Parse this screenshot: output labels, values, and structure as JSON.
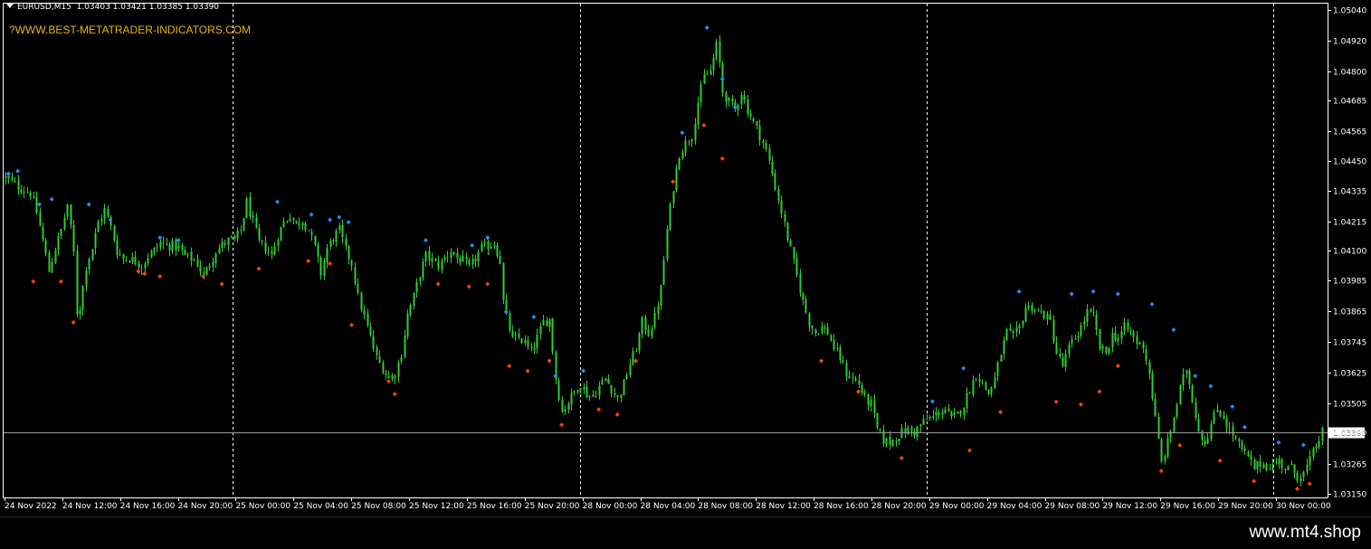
{
  "chart": {
    "symbol": "EURUSD,M15",
    "ohlc": "1.03403 1.03421 1.03385 1.03390",
    "watermark": "?WWW.BEST-METATRADER-INDICATORS.COM",
    "current_price": "1.03390",
    "colors": {
      "background": "#000000",
      "candle": "#32cd32",
      "high_marker": "#1e90ff",
      "low_marker": "#ff4500",
      "watermark": "#e8b317",
      "grid_line": "#ffffff"
    }
  },
  "price_axis": {
    "ticks": [
      "1.05040",
      "1.04920",
      "1.04800",
      "1.04685",
      "1.04565",
      "1.04450",
      "1.04335",
      "1.04215",
      "1.04100",
      "1.03985",
      "1.03865",
      "1.03745",
      "1.03625",
      "1.03505",
      "1.03390",
      "1.03265",
      "1.03150"
    ]
  },
  "time_axis": {
    "labels": [
      "24 Nov 2022",
      "24 Nov 12:00",
      "24 Nov 16:00",
      "24 Nov 20:00",
      "25 Nov 00:00",
      "25 Nov 04:00",
      "25 Nov 08:00",
      "25 Nov 12:00",
      "25 Nov 16:00",
      "25 Nov 20:00",
      "28 Nov 00:00",
      "28 Nov 04:00",
      "28 Nov 08:00",
      "28 Nov 12:00",
      "28 Nov 16:00",
      "28 Nov 20:00",
      "29 Nov 00:00",
      "29 Nov 04:00",
      "29 Nov 08:00",
      "29 Nov 12:00",
      "29 Nov 16:00",
      "29 Nov 20:00",
      "30 Nov 00:00"
    ],
    "day_separators": [
      "25 Nov 00:00",
      "28 Nov 00:00",
      "29 Nov 00:00",
      "30 Nov 00:00"
    ]
  },
  "chart_data": {
    "type": "candlestick",
    "x": [
      "24 Nov 2022",
      "24 Nov 12:00",
      "24 Nov 16:00",
      "24 Nov 20:00",
      "25 Nov 00:00",
      "25 Nov 04:00",
      "25 Nov 08:00",
      "25 Nov 12:00",
      "25 Nov 16:00",
      "25 Nov 20:00",
      "28 Nov 00:00",
      "28 Nov 04:00",
      "28 Nov 08:00",
      "28 Nov 12:00",
      "28 Nov 16:00",
      "28 Nov 20:00",
      "29 Nov 00:00",
      "29 Nov 04:00",
      "29 Nov 08:00",
      "29 Nov 12:00",
      "29 Nov 16:00",
      "29 Nov 20:00",
      "30 Nov 00:00"
    ],
    "close_path": [
      [
        0,
        1.04385
      ],
      [
        4,
        1.0435
      ],
      [
        8,
        1.04325
      ],
      [
        10,
        1.0425
      ],
      [
        12,
        1.0414
      ],
      [
        14,
        1.0402
      ],
      [
        16,
        1.0411
      ],
      [
        18,
        1.0418
      ],
      [
        20,
        1.0428
      ],
      [
        22,
        1.0409
      ],
      [
        23,
        1.0386
      ],
      [
        24,
        1.0388
      ],
      [
        26,
        1.0404
      ],
      [
        28,
        1.0411
      ],
      [
        30,
        1.0421
      ],
      [
        32,
        1.0426
      ],
      [
        34,
        1.0419
      ],
      [
        36,
        1.041
      ],
      [
        38,
        1.0407
      ],
      [
        40,
        1.0407
      ],
      [
        42,
        1.0406
      ],
      [
        44,
        1.0404
      ],
      [
        46,
        1.0408
      ],
      [
        48,
        1.041
      ],
      [
        50,
        1.0413
      ],
      [
        52,
        1.0412
      ],
      [
        54,
        1.0412
      ],
      [
        56,
        1.0411
      ],
      [
        58,
        1.0408
      ],
      [
        60,
        1.0407
      ],
      [
        62,
        1.0405
      ],
      [
        64,
        1.04
      ],
      [
        66,
        1.0405
      ],
      [
        68,
        1.041
      ],
      [
        70,
        1.0412
      ],
      [
        72,
        1.0414
      ],
      [
        74,
        1.0414
      ],
      [
        76,
        1.0418
      ],
      [
        78,
        1.0429
      ],
      [
        80,
        1.0421
      ],
      [
        82,
        1.0413
      ],
      [
        84,
        1.0411
      ],
      [
        86,
        1.0408
      ],
      [
        88,
        1.0416
      ],
      [
        90,
        1.0421
      ],
      [
        92,
        1.0424
      ],
      [
        94,
        1.042
      ],
      [
        96,
        1.0422
      ],
      [
        98,
        1.0418
      ],
      [
        100,
        1.0411
      ],
      [
        102,
        1.0401
      ],
      [
        104,
        1.0411
      ],
      [
        106,
        1.0415
      ],
      [
        108,
        1.0418
      ],
      [
        110,
        1.041
      ],
      [
        112,
        1.0405
      ],
      [
        114,
        1.0392
      ],
      [
        116,
        1.0384
      ],
      [
        118,
        1.0376
      ],
      [
        120,
        1.0368
      ],
      [
        122,
        1.0364
      ],
      [
        124,
        1.036
      ],
      [
        126,
        1.0362
      ],
      [
        128,
        1.037
      ],
      [
        130,
        1.0385
      ],
      [
        132,
        1.0392
      ],
      [
        134,
        1.0401
      ],
      [
        136,
        1.0408
      ],
      [
        138,
        1.0406
      ],
      [
        140,
        1.0404
      ],
      [
        142,
        1.0407
      ],
      [
        144,
        1.041
      ],
      [
        146,
        1.0407
      ],
      [
        148,
        1.0406
      ],
      [
        150,
        1.0403
      ],
      [
        152,
        1.0407
      ],
      [
        154,
        1.0411
      ],
      [
        156,
        1.0412
      ],
      [
        158,
        1.0413
      ],
      [
        160,
        1.0406
      ],
      [
        161,
        1.039
      ],
      [
        162,
        1.0384
      ],
      [
        164,
        1.0375
      ],
      [
        166,
        1.0376
      ],
      [
        168,
        1.0374
      ],
      [
        170,
        1.037
      ],
      [
        172,
        1.0376
      ],
      [
        174,
        1.0382
      ],
      [
        176,
        1.0383
      ],
      [
        178,
        1.036
      ],
      [
        180,
        1.0347
      ],
      [
        182,
        1.0351
      ],
      [
        184,
        1.0355
      ],
      [
        186,
        1.0358
      ],
      [
        188,
        1.0354
      ],
      [
        190,
        1.0353
      ],
      [
        192,
        1.0357
      ],
      [
        194,
        1.036
      ],
      [
        196,
        1.0356
      ],
      [
        198,
        1.0352
      ],
      [
        200,
        1.0358
      ],
      [
        202,
        1.0366
      ],
      [
        204,
        1.0372
      ],
      [
        206,
        1.0382
      ],
      [
        208,
        1.0378
      ],
      [
        210,
        1.0384
      ],
      [
        212,
        1.0395
      ],
      [
        214,
        1.0418
      ],
      [
        216,
        1.0435
      ],
      [
        218,
        1.0448
      ],
      [
        220,
        1.0452
      ],
      [
        222,
        1.0455
      ],
      [
        224,
        1.0468
      ],
      [
        226,
        1.0478
      ],
      [
        228,
        1.048
      ],
      [
        230,
        1.049
      ],
      [
        231,
        1.0483
      ],
      [
        232,
        1.0472
      ],
      [
        234,
        1.0468
      ],
      [
        236,
        1.0465
      ],
      [
        238,
        1.0472
      ],
      [
        240,
        1.0465
      ],
      [
        242,
        1.046
      ],
      [
        244,
        1.0455
      ],
      [
        246,
        1.0449
      ],
      [
        248,
        1.044
      ],
      [
        250,
        1.043
      ],
      [
        252,
        1.042
      ],
      [
        254,
        1.041
      ],
      [
        256,
        1.04
      ],
      [
        258,
        1.039
      ],
      [
        260,
        1.0382
      ],
      [
        262,
        1.0378
      ],
      [
        264,
        1.038
      ],
      [
        266,
        1.0378
      ],
      [
        268,
        1.0372
      ],
      [
        270,
        1.0368
      ],
      [
        272,
        1.0362
      ],
      [
        274,
        1.036
      ],
      [
        276,
        1.0358
      ],
      [
        278,
        1.0352
      ],
      [
        280,
        1.035
      ],
      [
        282,
        1.034
      ],
      [
        284,
        1.0336
      ],
      [
        286,
        1.0335
      ],
      [
        288,
        1.0337
      ],
      [
        290,
        1.0339
      ],
      [
        292,
        1.034
      ],
      [
        294,
        1.0339
      ],
      [
        296,
        1.0342
      ],
      [
        298,
        1.0344
      ],
      [
        300,
        1.0345
      ],
      [
        302,
        1.0347
      ],
      [
        304,
        1.0348
      ],
      [
        306,
        1.0344
      ],
      [
        308,
        1.0346
      ],
      [
        310,
        1.035
      ],
      [
        312,
        1.0356
      ],
      [
        314,
        1.0362
      ],
      [
        316,
        1.0358
      ],
      [
        318,
        1.0354
      ],
      [
        320,
        1.036
      ],
      [
        322,
        1.037
      ],
      [
        324,
        1.0378
      ],
      [
        326,
        1.0376
      ],
      [
        328,
        1.038
      ],
      [
        330,
        1.0388
      ],
      [
        332,
        1.0388
      ],
      [
        334,
        1.0386
      ],
      [
        336,
        1.0385
      ],
      [
        338,
        1.0382
      ],
      [
        340,
        1.037
      ],
      [
        342,
        1.0365
      ],
      [
        344,
        1.0372
      ],
      [
        346,
        1.0376
      ],
      [
        348,
        1.038
      ],
      [
        350,
        1.0386
      ],
      [
        352,
        1.0384
      ],
      [
        354,
        1.0372
      ],
      [
        356,
        1.037
      ],
      [
        358,
        1.0377
      ],
      [
        360,
        1.0376
      ],
      [
        362,
        1.038
      ],
      [
        364,
        1.0378
      ],
      [
        366,
        1.0374
      ],
      [
        368,
        1.0373
      ],
      [
        370,
        1.0362
      ],
      [
        372,
        1.0344
      ],
      [
        374,
        1.0327
      ],
      [
        376,
        1.0335
      ],
      [
        378,
        1.0345
      ],
      [
        380,
        1.0356
      ],
      [
        382,
        1.0364
      ],
      [
        384,
        1.0352
      ],
      [
        386,
        1.034
      ],
      [
        388,
        1.0335
      ],
      [
        390,
        1.0342
      ],
      [
        392,
        1.0348
      ],
      [
        394,
        1.0345
      ],
      [
        396,
        1.034
      ],
      [
        398,
        1.0336
      ],
      [
        400,
        1.0332
      ],
      [
        402,
        1.0329
      ],
      [
        404,
        1.0325
      ],
      [
        406,
        1.0327
      ],
      [
        408,
        1.0326
      ],
      [
        410,
        1.0326
      ],
      [
        412,
        1.0328
      ],
      [
        414,
        1.0325
      ],
      [
        416,
        1.0325
      ],
      [
        418,
        1.0322
      ],
      [
        420,
        1.0323
      ],
      [
        422,
        1.0328
      ],
      [
        424,
        1.0334
      ],
      [
        426,
        1.0339
      ]
    ],
    "swing_highs": [
      [
        1,
        1.0439
      ],
      [
        4,
        1.044
      ],
      [
        15,
        1.0429
      ],
      [
        11,
        1.0427
      ],
      [
        27,
        1.0427
      ],
      [
        34,
        1.0421
      ],
      [
        50,
        1.0414
      ],
      [
        56,
        1.0413
      ],
      [
        88,
        1.0428
      ],
      [
        99,
        1.0423
      ],
      [
        105,
        1.0421
      ],
      [
        108,
        1.0422
      ],
      [
        111,
        1.042
      ],
      [
        136,
        1.0413
      ],
      [
        151,
        1.0411
      ],
      [
        156,
        1.0414
      ],
      [
        162,
        1.0385
      ],
      [
        171,
        1.0383
      ],
      [
        178,
        1.036
      ],
      [
        187,
        1.0362
      ],
      [
        219,
        1.0455
      ],
      [
        227,
        1.0496
      ],
      [
        232,
        1.0476
      ],
      [
        236,
        1.0465
      ],
      [
        300,
        1.035
      ],
      [
        310,
        1.0363
      ],
      [
        328,
        1.0393
      ],
      [
        345,
        1.0392
      ],
      [
        352,
        1.0393
      ],
      [
        360,
        1.0392
      ],
      [
        371,
        1.0388
      ],
      [
        378,
        1.0378
      ],
      [
        385,
        1.036
      ],
      [
        390,
        1.0356
      ],
      [
        397,
        1.0348
      ],
      [
        401,
        1.034
      ],
      [
        412,
        1.0334
      ],
      [
        420,
        1.0333
      ]
    ],
    "swing_lows": [
      [
        9,
        1.0399
      ],
      [
        18,
        1.0399
      ],
      [
        22,
        1.0383
      ],
      [
        43,
        1.0403
      ],
      [
        45,
        1.0402
      ],
      [
        50,
        1.0401
      ],
      [
        64,
        1.0401
      ],
      [
        70,
        1.0398
      ],
      [
        82,
        1.0404
      ],
      [
        98,
        1.0407
      ],
      [
        105,
        1.0406
      ],
      [
        112,
        1.0382
      ],
      [
        124,
        1.036
      ],
      [
        126,
        1.0355
      ],
      [
        140,
        1.0398
      ],
      [
        150,
        1.0397
      ],
      [
        156,
        1.0398
      ],
      [
        163,
        1.0366
      ],
      [
        169,
        1.0364
      ],
      [
        176,
        1.0368
      ],
      [
        180,
        1.0343
      ],
      [
        192,
        1.0349
      ],
      [
        198,
        1.0347
      ],
      [
        204,
        1.0368
      ],
      [
        216,
        1.0438
      ],
      [
        226,
        1.046
      ],
      [
        232,
        1.0447
      ],
      [
        264,
        1.0368
      ],
      [
        276,
        1.0356
      ],
      [
        290,
        1.033
      ],
      [
        312,
        1.0333
      ],
      [
        322,
        1.0348
      ],
      [
        340,
        1.0352
      ],
      [
        348,
        1.0351
      ],
      [
        354,
        1.0356
      ],
      [
        360,
        1.0366
      ],
      [
        374,
        1.0325
      ],
      [
        380,
        1.0335
      ],
      [
        393,
        1.0329
      ],
      [
        404,
        1.0321
      ],
      [
        418,
        1.0318
      ],
      [
        422,
        1.032
      ]
    ]
  }
}
